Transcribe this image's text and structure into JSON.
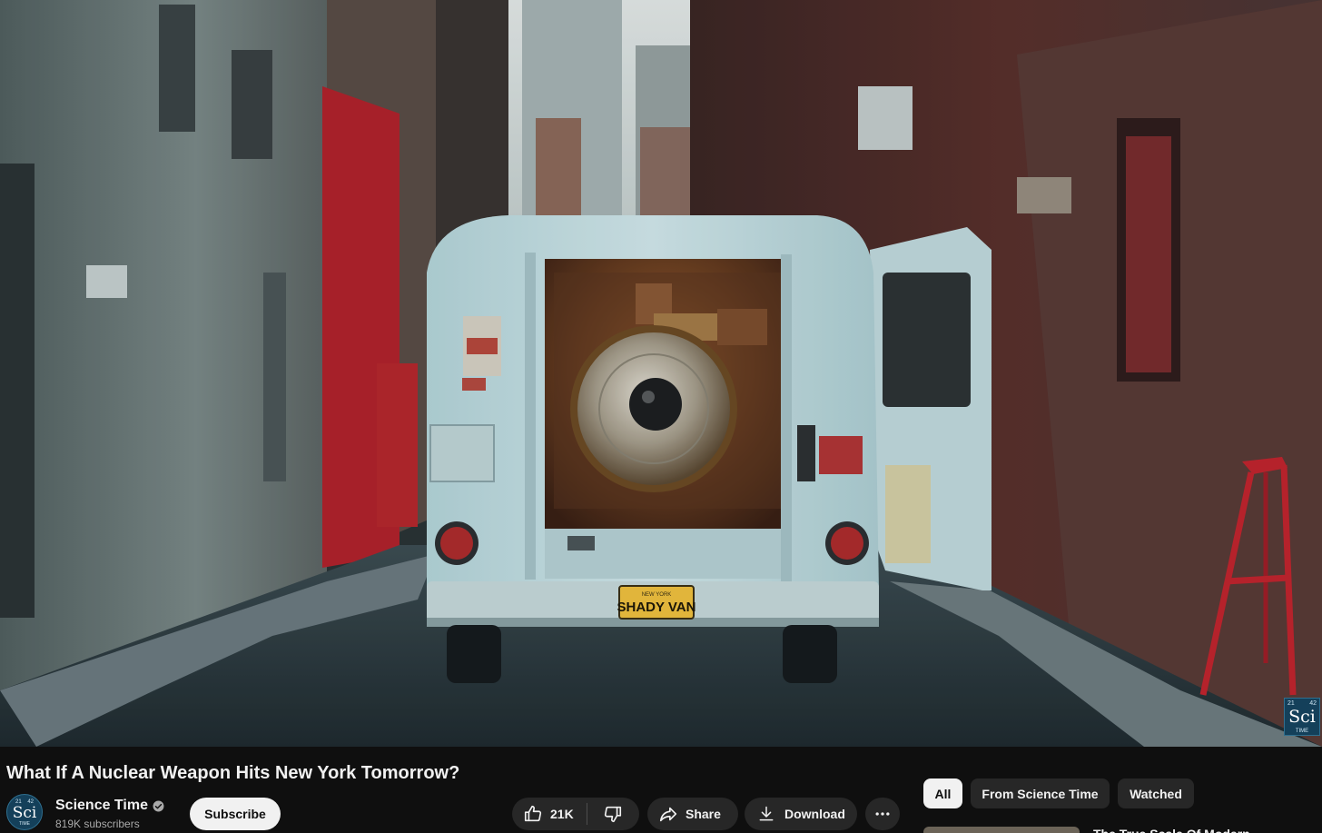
{
  "player": {
    "plate_text": "SHADY VAN",
    "plate_state": "NEW YORK",
    "watermark": {
      "num_left": "21",
      "num_right": "42",
      "symbol": "Sci",
      "name": "TIME"
    }
  },
  "video": {
    "title": "What If A Nuclear Weapon Hits New York Tomorrow?"
  },
  "channel": {
    "name": "Science Time",
    "subscribers": "819K subscribers",
    "subscribe_label": "Subscribe",
    "avatar": {
      "num_left": "21",
      "num_right": "42",
      "symbol": "Sci",
      "name": "TIME"
    }
  },
  "actions": {
    "like_count": "21K",
    "share_label": "Share",
    "download_label": "Download"
  },
  "chips": {
    "all": "All",
    "from_channel": "From Science Time",
    "watched": "Watched"
  },
  "recommended": {
    "first_title": "The True Scale Of Modern ..."
  },
  "colors": {
    "background": "#0f0f0f",
    "pill": "#272727",
    "subscribe_bg": "#f1f1f1",
    "muted_text": "#aaaaaa"
  },
  "icons": [
    "verified-icon",
    "thumbs-up-icon",
    "thumbs-down-icon",
    "share-icon",
    "download-icon",
    "more-icon"
  ]
}
